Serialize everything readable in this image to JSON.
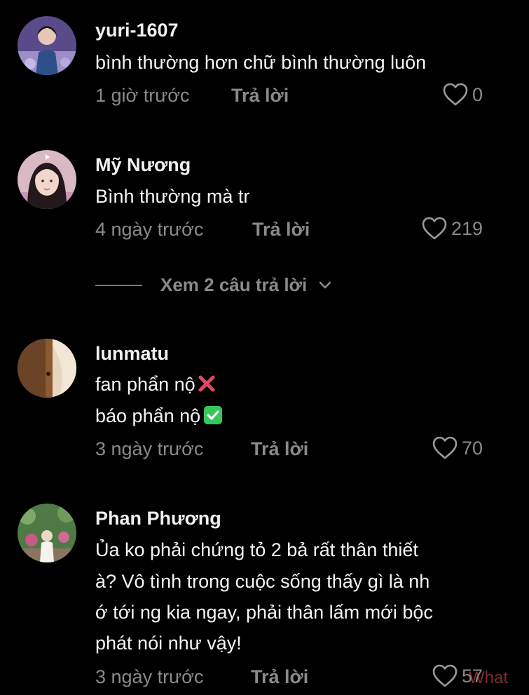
{
  "comments": [
    {
      "username": "yuri-1607",
      "lines": [
        "bình thường hơn chữ bình thường luôn"
      ],
      "time": "1 giờ trước",
      "reply_label": "Trả lời",
      "likes": "0"
    },
    {
      "username": "Mỹ Nương",
      "lines": [
        "Bình thường mà tr"
      ],
      "time": "4 ngày trước",
      "reply_label": "Trả lời",
      "likes": "219"
    },
    {
      "username": "lunmatu",
      "lines": [
        "fan phẩn nộ",
        "báo phẩn nộ"
      ],
      "emojis": [
        "cross-mark-emoji",
        "check-mark-emoji"
      ],
      "time": "3 ngày trước",
      "reply_label": "Trả lời",
      "likes": "70"
    },
    {
      "username": "Phan Phương",
      "lines": [
        "Ủa ko phải chứng tỏ 2 bả rất thân thiết",
        "à? Vô tình trong cuộc sống thấy gì là nh",
        "ớ tới ng kia ngay, phải thân lấm mới bộc",
        "phát nói như vậy!"
      ],
      "time": "3 ngày trước",
      "reply_label": "Trả lời",
      "likes": "57"
    }
  ],
  "view_replies": {
    "label": "Xem 2 câu trả lời",
    "icon": "chevron-down-icon"
  },
  "watermark": "What",
  "colors": {
    "background": "#000000",
    "primary_text": "#f5f5f5",
    "secondary_text": "#8a8a8a",
    "check_emoji": "#34c759",
    "cross_emoji": "#e8455e"
  }
}
